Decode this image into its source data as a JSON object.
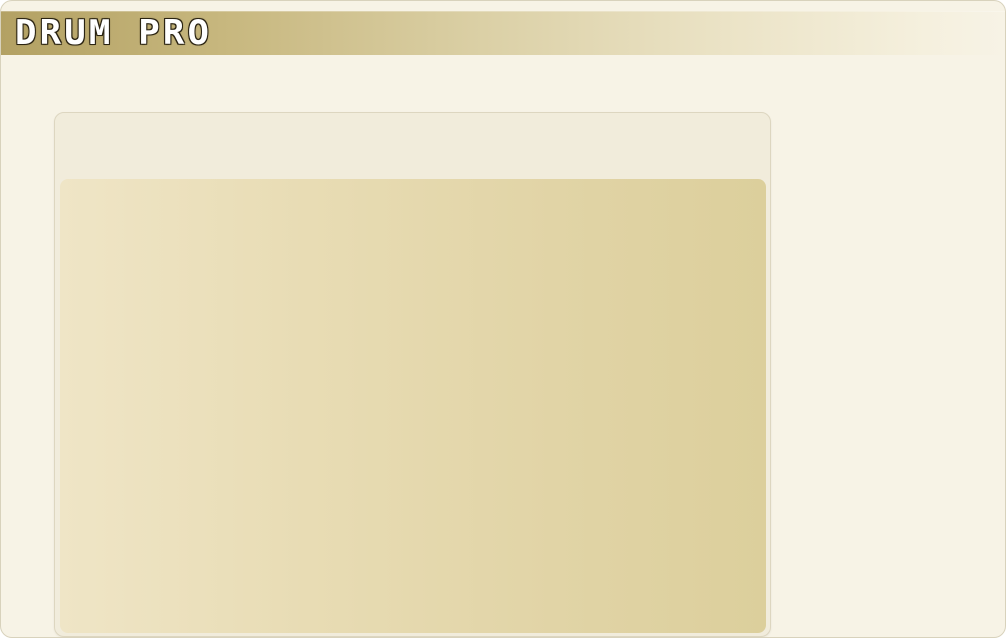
{
  "app": {
    "title": "DRUM PRO"
  },
  "colors": {
    "window_bg": "#f7f3e6",
    "title_gold": "#b3a163",
    "panel_body_left": "#efe5c6",
    "panel_body_right": "#dccf9c"
  }
}
